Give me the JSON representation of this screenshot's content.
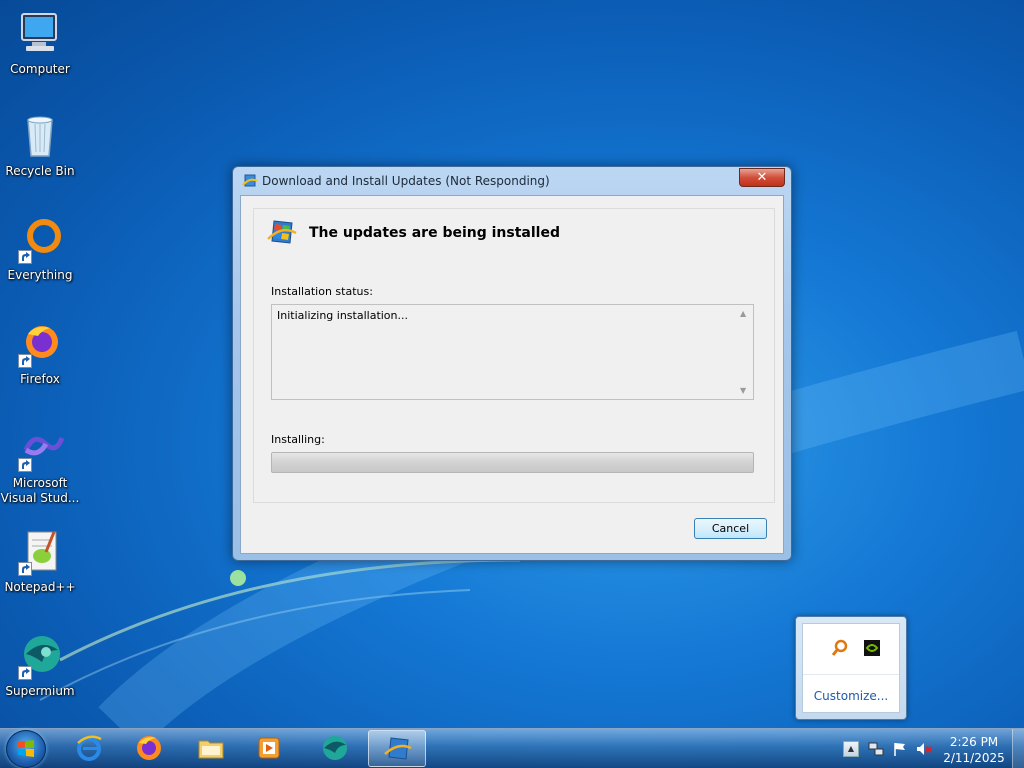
{
  "desktop": {
    "icons": [
      {
        "label": "Computer"
      },
      {
        "label": "Recycle Bin"
      },
      {
        "label": "Everything"
      },
      {
        "label": "Firefox"
      },
      {
        "label": "Microsoft Visual Stud..."
      },
      {
        "label": "Notepad++"
      },
      {
        "label": "Supermium"
      }
    ]
  },
  "window": {
    "title": "Download and Install Updates (Not Responding)",
    "close_label": "✕",
    "heading": "The updates are being installed",
    "status_label": "Installation status:",
    "status_text": "Initializing installation...",
    "installing_label": "Installing:",
    "progress_fraction": 0,
    "cancel_label": "Cancel"
  },
  "tray_popup": {
    "icons": [
      "everything-search-icon",
      "nvidia-icon"
    ],
    "customize_label": "Customize..."
  },
  "taskbar": {
    "pinned": [
      "internet-explorer-icon",
      "firefox-icon",
      "file-explorer-icon",
      "media-player-icon",
      "supermium-icon",
      "windows-update-icon"
    ],
    "tray_icons": [
      "show-hidden-icons",
      "network-icon",
      "action-center-flag-icon",
      "volume-muted-icon"
    ],
    "time": "2:26 PM",
    "date": "2/11/2025"
  },
  "colors": {
    "accent": "#1478d4",
    "progress_track": "#d2d2d2",
    "link": "#1e5aa8"
  }
}
